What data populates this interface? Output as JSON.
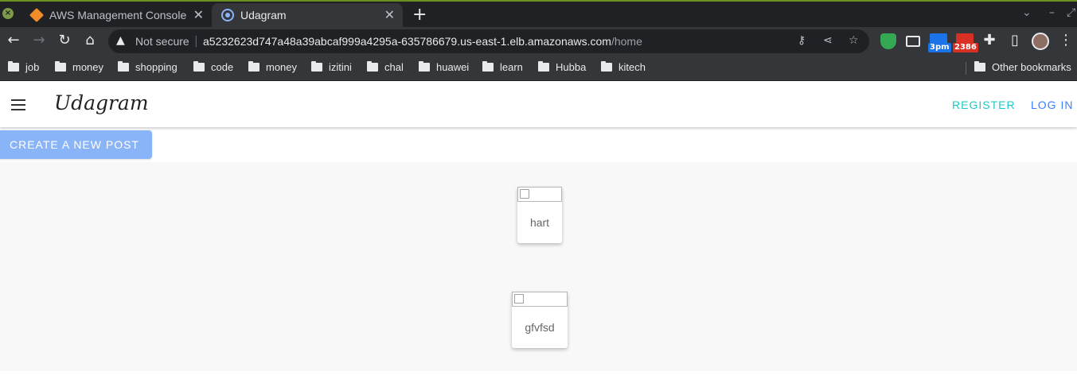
{
  "browser": {
    "tabs": [
      {
        "title": "AWS Management Console",
        "icon": "aws-cube-icon",
        "active": false
      },
      {
        "title": "Udagram",
        "icon": "udagram-favicon",
        "active": true
      }
    ],
    "new_tab_label": "+",
    "address": {
      "security_label": "Not secure",
      "host": "a5232623d747a48a39abcaf999a4295a-635786679.us-east-1.elb.amazonaws.com",
      "path": "/home"
    },
    "extension_badges": {
      "calendar": "3pm",
      "mail": "2386"
    },
    "bookmarks": [
      "job",
      "money",
      "shopping",
      "code",
      "money",
      "izitini",
      "chal",
      "huawei",
      "learn",
      "Hubba",
      "kitech"
    ],
    "other_bookmarks": "Other bookmarks"
  },
  "app": {
    "brand": "Udagram",
    "nav": {
      "register": "REGISTER",
      "login": "LOG IN"
    },
    "create_button": "CREATE A NEW POST",
    "posts": [
      {
        "caption": "hart"
      },
      {
        "caption": "gfvfsd"
      }
    ]
  },
  "colors": {
    "register": "#1ec9c9",
    "login": "#3880ff",
    "create_button": "#8ab4f8"
  }
}
